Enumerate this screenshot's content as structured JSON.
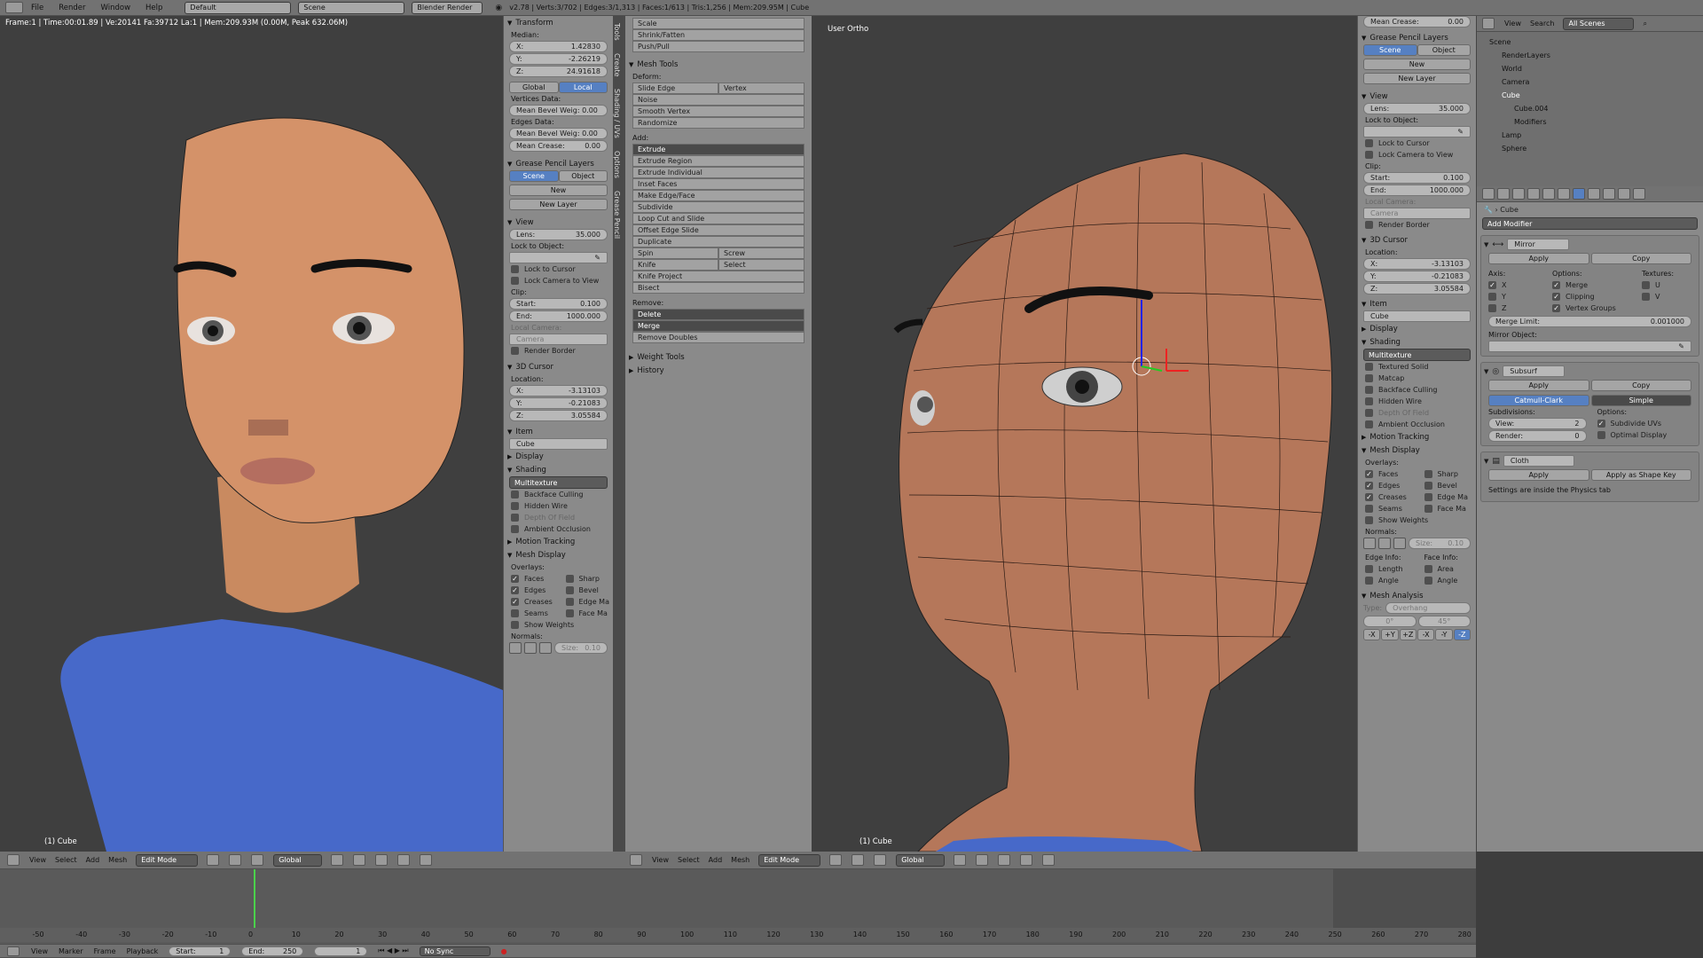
{
  "topbar": {
    "menus": [
      "File",
      "Render",
      "Window",
      "Help"
    ],
    "layout": "Default",
    "scene": "Scene",
    "engine": "Blender Render",
    "stats": "v2.78 | Verts:3/702 | Edges:3/1,313 | Faces:1/613 | Tris:1,256 | Mem:209.95M | Cube"
  },
  "left_view": {
    "info": "Frame:1 | Time:00:01.89 | Ve:20141 Fa:39712 La:1 | Mem:209.93M (0.00M, Peak 632.06M)",
    "object": "(1) Cube"
  },
  "right_view": {
    "label": "User Ortho",
    "object": "(1) Cube"
  },
  "props_left": {
    "transform": "Transform",
    "median": "Median:",
    "x_l": "X:",
    "x": "1.42830",
    "y_l": "Y:",
    "y": "-2.26219",
    "z_l": "Z:",
    "z": "24.91618",
    "global": "Global",
    "local": "Local",
    "vertices_data": "Vertices Data:",
    "mean_bevel": "Mean Bevel Weig: 0.00",
    "edges_data": "Edges Data:",
    "mean_bevel2": "Mean Bevel Weig: 0.00",
    "mean_crease": "Mean Crease:",
    "crease_val": "0.00",
    "grease": "Grease Pencil Layers",
    "scene": "Scene",
    "object": "Object",
    "new": "New",
    "new_layer": "New Layer",
    "view": "View",
    "lens_l": "Lens:",
    "lens": "35.000",
    "lock_obj": "Lock to Object:",
    "lock_cursor": "Lock to Cursor",
    "lock_camera": "Lock Camera to View",
    "clip": "Clip:",
    "start_l": "Start:",
    "start": "0.100",
    "end_l": "End:",
    "end": "1000.000",
    "local_camera": "Local Camera:",
    "camera": "Camera",
    "render_border": "Render Border",
    "cursor3d": "3D Cursor",
    "location": "Location:",
    "cx": "-3.13103",
    "cy": "-0.21083",
    "cz": "3.05584",
    "item": "Item",
    "cube": "Cube",
    "display": "Display",
    "shading": "Shading",
    "multitex": "Multitexture",
    "backface": "Backface Culling",
    "hidden_wire": "Hidden Wire",
    "dof": "Depth Of Field",
    "ao": "Ambient Occlusion",
    "motion": "Motion Tracking",
    "mesh_display": "Mesh Display",
    "overlays": "Overlays:",
    "faces": "Faces",
    "sharp": "Sharp",
    "edges": "Edges",
    "bevel": "Bevel",
    "creases": "Creases",
    "edge_ma": "Edge Ma",
    "seams": "Seams",
    "face_ma": "Face Ma",
    "show_weights": "Show Weights",
    "normals": "Normals:",
    "size": "Size:",
    "size_val": "0.10"
  },
  "tools": {
    "tabs": [
      "Tools",
      "Create",
      "Shading / UVs",
      "Options",
      "Grease Pencil"
    ],
    "top": [
      "Scale",
      "Shrink/Fatten",
      "Push/Pull"
    ],
    "mesh_tools": "Mesh Tools",
    "deform": "Deform:",
    "slide_edge": "Slide Edge",
    "vertex": "Vertex",
    "noise": "Noise",
    "smooth_vertex": "Smooth Vertex",
    "randomize": "Randomize",
    "add": "Add:",
    "extrude": "Extrude",
    "extrude_region": "Extrude Region",
    "extrude_individual": "Extrude Individual",
    "inset": "Inset Faces",
    "make_edge": "Make Edge/Face",
    "subdivide": "Subdivide",
    "loop_cut": "Loop Cut and Slide",
    "offset_edge": "Offset Edge Slide",
    "duplicate": "Duplicate",
    "spin": "Spin",
    "screw": "Screw",
    "knife": "Knife",
    "select": "Select",
    "knife_project": "Knife Project",
    "bisect": "Bisect",
    "remove": "Remove:",
    "delete": "Delete",
    "merge": "Merge",
    "remove_doubles": "Remove Doubles",
    "weight_tools": "Weight Tools",
    "history": "History"
  },
  "props_right": {
    "mean_crease": "Mean Crease:",
    "crease_val": "0.00",
    "grease": "Grease Pencil Layers",
    "scene": "Scene",
    "object": "Object",
    "new": "New",
    "new_layer": "New Layer",
    "view": "View",
    "lens_l": "Lens:",
    "lens": "35.000",
    "lock_obj": "Lock to Object:",
    "lock_cursor": "Lock to Cursor",
    "lock_camera": "Lock Camera to View",
    "clip": "Clip:",
    "start_l": "Start:",
    "start": "0.100",
    "end_l": "End:",
    "end": "1000.000",
    "local_camera": "Local Camera:",
    "camera": "Camera",
    "render_border": "Render Border",
    "cursor3d": "3D Cursor",
    "location": "Location:",
    "x_l": "X:",
    "y_l": "Y:",
    "z_l": "Z:",
    "cx": "-3.13103",
    "cy": "-0.21083",
    "cz": "3.05584",
    "item": "Item",
    "cube": "Cube",
    "display": "Display",
    "shading": "Shading",
    "multitex": "Multitexture",
    "textured_solid": "Textured Solid",
    "matcap": "Matcap",
    "backface": "Backface Culling",
    "hidden_wire": "Hidden Wire",
    "dof": "Depth Of Field",
    "ao": "Ambient Occlusion",
    "motion": "Motion Tracking",
    "mesh_display": "Mesh Display",
    "overlays": "Overlays:",
    "faces": "Faces",
    "sharp": "Sharp",
    "edges": "Edges",
    "bevel": "Bevel",
    "creases": "Creases",
    "edge_ma": "Edge Ma",
    "seams": "Seams",
    "face_ma": "Face Ma",
    "show_weights": "Show Weights",
    "normals": "Normals:",
    "size": "Size:",
    "size_val": "0.10",
    "edge_info": "Edge Info:",
    "face_info": "Face Info:",
    "length": "Length",
    "area": "Area",
    "angle": "Angle",
    "angle2": "Angle",
    "mesh_analysis": "Mesh Analysis",
    "type_l": "Type:",
    "overhang": "Overhang",
    "deg0": "0°",
    "deg45": "45°",
    "axes": [
      "-X",
      "+Y",
      "+Z",
      "-X",
      "-Y",
      "-Z"
    ]
  },
  "outliner": {
    "menus": [
      "View",
      "Search"
    ],
    "filter": "All Scenes",
    "items": [
      "Scene",
      "RenderLayers",
      "World",
      "Camera",
      "Cube",
      "Cube.004",
      "Modifiers",
      "Lamp",
      "Sphere"
    ]
  },
  "modifiers": {
    "object": "Cube",
    "add_modifier": "Add Modifier",
    "mirror": "Mirror",
    "apply": "Apply",
    "copy": "Copy",
    "axis": "Axis:",
    "options": "Options:",
    "textures": "Textures:",
    "x": "X",
    "y": "Y",
    "z": "Z",
    "merge": "Merge",
    "clipping": "Clipping",
    "vertex_groups": "Vertex Groups",
    "u": "U",
    "v": "V",
    "merge_limit": "Merge Limit:",
    "merge_limit_val": "0.001000",
    "mirror_object": "Mirror Object:",
    "subsurf": "Subsurf",
    "catmull": "Catmull-Clark",
    "simple": "Simple",
    "subdivisions": "Subdivisions:",
    "view_l": "View:",
    "view_val": "2",
    "render_l": "Render:",
    "render_val": "0",
    "subdivide_uvs": "Subdivide UVs",
    "optimal": "Optimal Display",
    "cloth": "Cloth",
    "apply_shape": "Apply as Shape Key",
    "cloth_note": "Settings are inside the Physics tab"
  },
  "header3d": {
    "menus": [
      "View",
      "Select",
      "Add",
      "Mesh"
    ],
    "mode": "Edit Mode",
    "orient": "Global"
  },
  "timeline": {
    "ticks": [
      "-50",
      "-40",
      "-30",
      "-20",
      "-10",
      "0",
      "10",
      "20",
      "30",
      "40",
      "50",
      "60",
      "70",
      "80",
      "90",
      "100",
      "110",
      "120",
      "130",
      "140",
      "150",
      "160",
      "170",
      "180",
      "190",
      "200",
      "210",
      "220",
      "230",
      "240",
      "250",
      "260",
      "270",
      "280"
    ],
    "menus": [
      "View",
      "Marker",
      "Frame",
      "Playback"
    ],
    "start_l": "Start:",
    "start": "1",
    "end_l": "End:",
    "end": "250",
    "current": "1",
    "sync": "No Sync"
  }
}
